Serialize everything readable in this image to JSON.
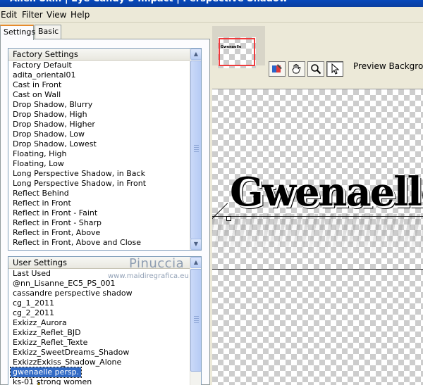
{
  "window": {
    "title": "Alien Skin | Eye Candy 5 Impact | Perspective Shadow"
  },
  "menu": [
    "Edit",
    "Filter",
    "View",
    "Help"
  ],
  "tabs": [
    {
      "label": "Settings",
      "active": true
    },
    {
      "label": "Basic",
      "active": false
    }
  ],
  "factory_settings": {
    "header": "Factory Settings",
    "items": [
      "Factory Default",
      "adita_oriental01",
      "Cast in Front",
      "Cast on Wall",
      "Drop Shadow, Blurry",
      "Drop Shadow, High",
      "Drop Shadow, Higher",
      "Drop Shadow, Low",
      "Drop Shadow, Lowest",
      "Floating, High",
      "Floating, Low",
      "Long Perspective Shadow, in Back",
      "Long Perspective Shadow, in Front",
      "Reflect Behind",
      "Reflect in Front",
      "Reflect in Front - Faint",
      "Reflect in Front - Sharp",
      "Reflect in Front, Above",
      "Reflect in Front, Above and Close"
    ]
  },
  "user_settings": {
    "header": "User Settings",
    "items": [
      "Last Used",
      "@nn_Lisanne_EC5_PS_001",
      "cassandre perspective shadow",
      "cg_1_2011",
      "cg_2_2011",
      "Exkizz_Aurora",
      "Exkizz_Reflet_BJD",
      "Exkizz_Reflet_Texte",
      "Exkizz_SweetDreams_Shadow",
      "ExkizzExkiss_Shadow_Alone",
      "gwenaelle persp.",
      "ks-01 strong women"
    ],
    "selected_index": 10
  },
  "watermark": {
    "name": "Pinuccia",
    "url": "www.maidiregrafica.eu"
  },
  "toolbar": {
    "preview_background_label": "Preview Background",
    "tools": [
      "preview-toggle-icon",
      "hand-icon",
      "zoom-icon",
      "pointer-icon"
    ],
    "active_tool": "pointer-icon"
  },
  "navigator": {
    "thumb_text": "Gwenaelle"
  },
  "preview": {
    "text": "Gwenaelle"
  },
  "colors": {
    "accent": "#316ac5",
    "title": "#0a5fd8",
    "navigator_frame": "#ee3b3b"
  }
}
